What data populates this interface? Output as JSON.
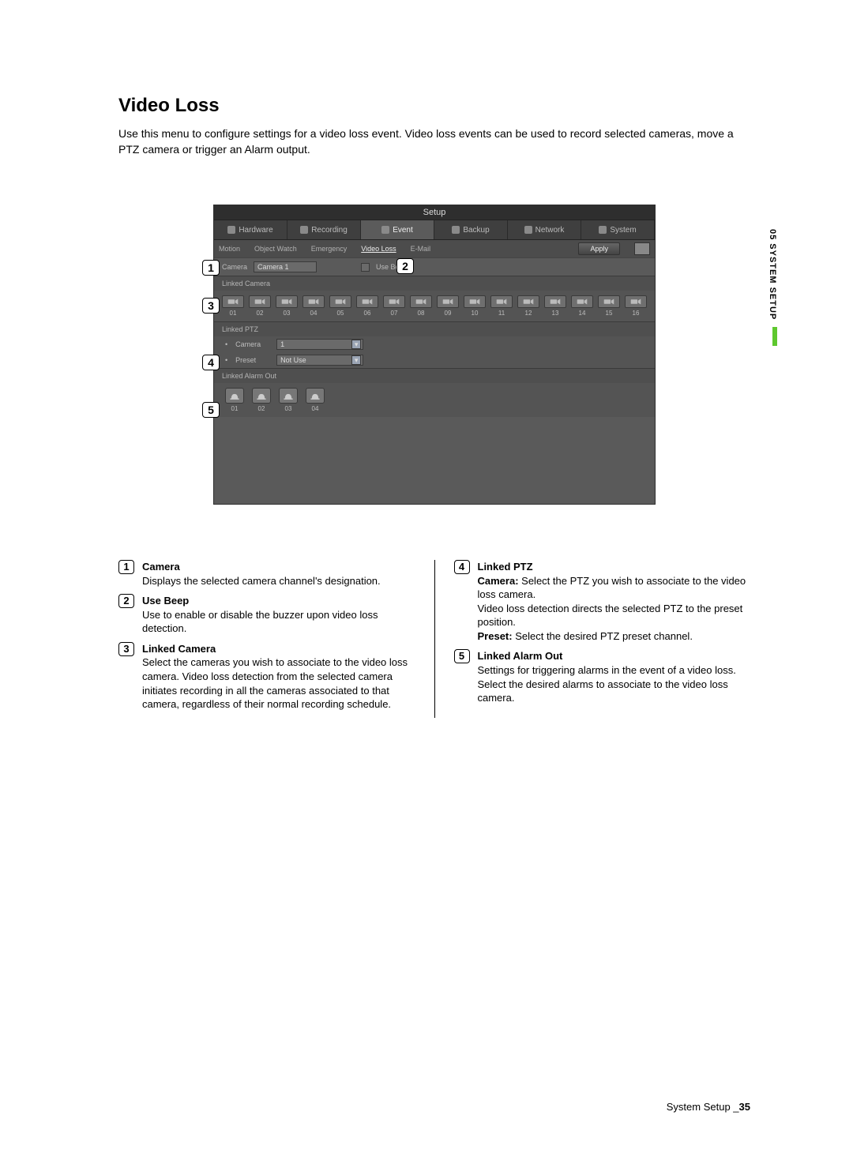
{
  "heading": "Video Loss",
  "intro": "Use this menu to configure settings for a video loss event. Video loss events can be used to record selected cameras, move a PTZ camera or trigger an Alarm output.",
  "sideTab": "05 SYSTEM SETUP",
  "footer": {
    "label": "System Setup _",
    "page": "35"
  },
  "shot": {
    "windowTitle": "Setup",
    "tabs": [
      "Hardware",
      "Recording",
      "Event",
      "Backup",
      "Network",
      "System"
    ],
    "activeTab": "Event",
    "subTabs": [
      "Motion",
      "Object Watch",
      "Emergency",
      "Video Loss",
      "E-Mail"
    ],
    "activeSubTab": "Video Loss",
    "applyLabel": "Apply",
    "cameraLabel": "Camera",
    "cameraValue": "Camera 1",
    "useBeepLabel": "Use Beep",
    "linkedCameraHeader": "Linked Camera",
    "cameraNumbers": [
      "01",
      "02",
      "03",
      "04",
      "05",
      "06",
      "07",
      "08",
      "09",
      "10",
      "11",
      "12",
      "13",
      "14",
      "15",
      "16"
    ],
    "linkedPtzHeader": "Linked PTZ",
    "ptzCameraLabel": "Camera",
    "ptzCameraValue": "1",
    "ptzPresetLabel": "Preset",
    "ptzPresetValue": "Not Use",
    "linkedAlarmHeader": "Linked Alarm Out",
    "alarmNumbers": [
      "01",
      "02",
      "03",
      "04"
    ]
  },
  "callouts": {
    "c1": "1",
    "c2": "2",
    "c3": "3",
    "c4": "4",
    "c5": "5"
  },
  "descriptions": {
    "d1": {
      "num": "1",
      "title": "Camera",
      "body": "Displays the selected camera channel's designation."
    },
    "d2": {
      "num": "2",
      "title": "Use Beep",
      "body": "Use to enable or disable the buzzer upon video loss detection."
    },
    "d3": {
      "num": "3",
      "title": "Linked Camera",
      "body": "Select the cameras you wish to associate to the video loss camera. Video loss detection from the selected camera initiates recording in all the cameras associated to that camera, regardless of their normal recording schedule."
    },
    "d4": {
      "num": "4",
      "title": "Linked PTZ",
      "camLabel": "Camera:",
      "camBody": "Select the PTZ you wish to associate to the video loss camera.\nVideo loss detection directs the selected PTZ to the preset position.",
      "presetLabel": "Preset:",
      "presetBody": "Select the desired PTZ preset channel."
    },
    "d5": {
      "num": "5",
      "title": "Linked Alarm Out",
      "body": "Settings for triggering alarms in the event of a video loss. Select the desired alarms to associate to the video loss camera."
    }
  }
}
